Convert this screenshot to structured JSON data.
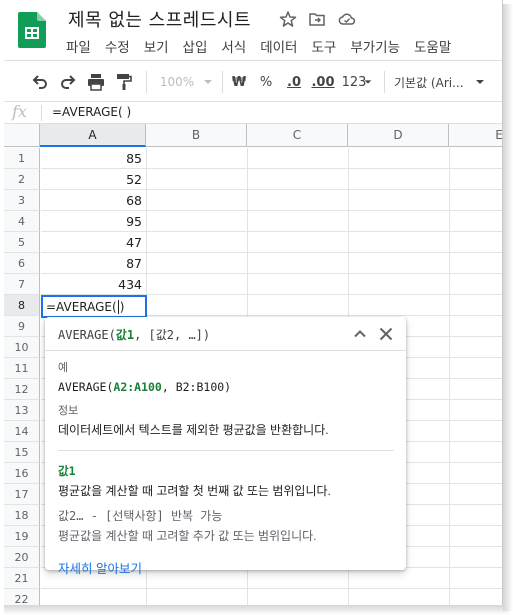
{
  "app": {
    "title": "제목 없는 스프레드시트",
    "brand_color": "#0f9d58",
    "accent_color": "#1a73e8",
    "title_icons": [
      "star-icon",
      "move-to-folder-icon",
      "cloud-status-icon"
    ]
  },
  "menu": [
    "파일",
    "수정",
    "보기",
    "삽입",
    "서식",
    "데이터",
    "도구",
    "부가기능",
    "도움말"
  ],
  "toolbar": {
    "zoom": "100%",
    "currency": "₩",
    "percent": "%",
    "decrease_decimal": ".0",
    "increase_decimal": ".00",
    "more_formats": "123",
    "font": "기본값 (Ari..."
  },
  "formula_bar": {
    "fx_label": "fx",
    "content": "=AVERAGE(    )"
  },
  "grid": {
    "columns": [
      "A",
      "B",
      "C",
      "D",
      "E"
    ],
    "rows": [
      "1",
      "2",
      "3",
      "4",
      "5",
      "6",
      "7",
      "8",
      "9",
      "10",
      "11",
      "12",
      "13",
      "14",
      "15",
      "16",
      "17",
      "18",
      "19",
      "20",
      "21",
      "22"
    ],
    "values": [
      "85",
      "52",
      "68",
      "95",
      "47",
      "87",
      "434"
    ],
    "active_cell": {
      "prefix": "=AVERAGE(",
      "suffix": ")"
    }
  },
  "tooltip": {
    "fn_name": "AVERAGE(",
    "arg1": "값1",
    "sig_rest": ", [값2, …])",
    "example_label": "예",
    "example_fn": "AVERAGE(",
    "example_arg": "A2:A100",
    "example_rest": ", B2:B100)",
    "info_label": "정보",
    "info_text": "데이터세트에서 텍스트를 제외한 평균값을 반환합니다.",
    "arg1_name": "값1",
    "arg1_desc": "평균값을 계산할 때 고려할 첫 번째 값 또는 범위입니다.",
    "arg2_name": "값2… - [선택사항] 반복 가능",
    "arg2_desc": "평균값을 계산할 때 고려할 추가 값 또는 범위입니다.",
    "learn_more": "자세히 알아보기"
  }
}
